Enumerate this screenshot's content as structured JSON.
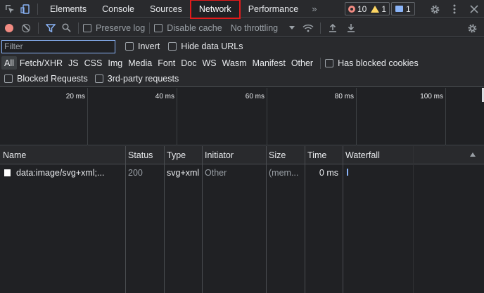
{
  "tabs": [
    "Elements",
    "Console",
    "Sources",
    "Network",
    "Performance"
  ],
  "active_tab": "Network",
  "more_tabs_glyph": "»",
  "counters": {
    "errors": "10",
    "warnings": "1",
    "issues": "1"
  },
  "colors": {
    "error": "#f28b82",
    "warning": "#fdd663",
    "accent": "#8ab4f8",
    "highlight": "#e21b1b"
  },
  "toolbar": {
    "preserve_log": "Preserve log",
    "disable_cache": "Disable cache",
    "throttling": "No throttling"
  },
  "filter": {
    "placeholder": "Filter",
    "invert": "Invert",
    "hide_data_urls": "Hide data URLs"
  },
  "type_filters": [
    "All",
    "Fetch/XHR",
    "JS",
    "CSS",
    "Img",
    "Media",
    "Font",
    "Doc",
    "WS",
    "Wasm",
    "Manifest",
    "Other"
  ],
  "has_blocked_cookies": "Has blocked cookies",
  "blocked_requests": "Blocked Requests",
  "third_party": "3rd-party requests",
  "overview_ticks": [
    "20 ms",
    "40 ms",
    "60 ms",
    "80 ms",
    "100 ms"
  ],
  "columns": [
    "Name",
    "Status",
    "Type",
    "Initiator",
    "Size",
    "Time",
    "Waterfall"
  ],
  "rows": [
    {
      "name": "data:image/svg+xml;...",
      "status": "200",
      "type": "svg+xml",
      "initiator": "Other",
      "size": "(mem...",
      "time": "0 ms"
    }
  ],
  "icons": {
    "inspect": "inspect-element-icon",
    "device": "device-toolbar-icon",
    "settings": "gear-icon",
    "more": "kebab-menu-icon",
    "close": "close-icon",
    "record": "record-icon",
    "clear": "clear-icon",
    "filter": "filter-icon",
    "search": "search-icon",
    "wifi": "network-conditions-icon",
    "upload": "import-har-icon",
    "download": "export-har-icon"
  }
}
